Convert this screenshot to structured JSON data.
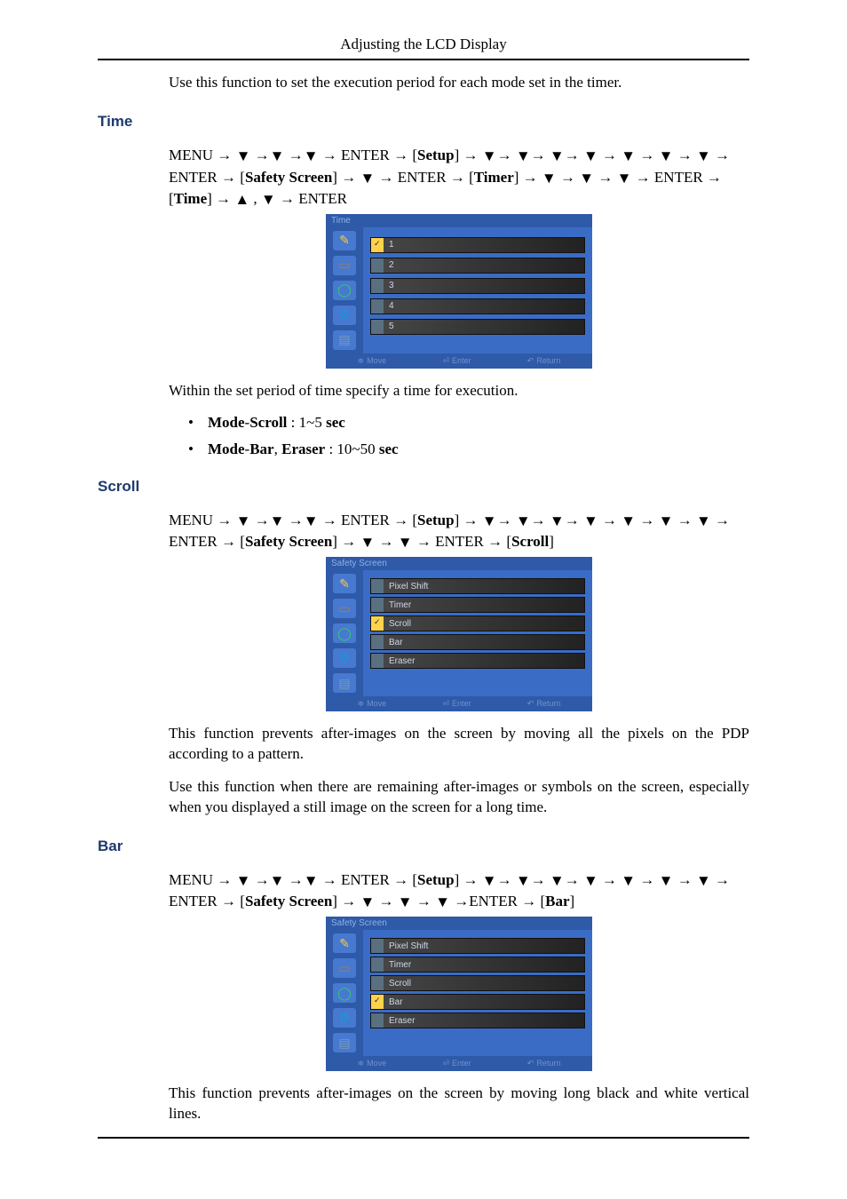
{
  "header_title": "Adjusting the LCD Display",
  "intro_para": "Use this function to set the execution period for each mode set in the timer.",
  "sections": {
    "time": {
      "heading": "Time",
      "nav_parts": {
        "p0": "MENU → ",
        "p1": " →",
        "p2": " →",
        "p3": " → ENTER → [",
        "setup": "Setup",
        "p4": "] → ",
        "p5": "→ ",
        "p6": "→ ",
        "p7": "→ ",
        "p8": " → ",
        "p9": " → ",
        "p10": " → ",
        "p11": " → ENTER → [",
        "safety": "Safety Screen",
        "p12": "] → ",
        "p13": " → ENTER → [",
        "timer": "Timer",
        "p14": "] → ",
        "p15": " → ",
        "p16": " → ",
        "p17": " → ENTER → [",
        "time": "Time",
        "p18": "] → ",
        "p19": " , ",
        "p20": " → ENTER"
      },
      "osd": {
        "title": "Time",
        "rows": [
          "1",
          "2",
          "3",
          "4",
          "5"
        ],
        "selected_index": 0,
        "foot": {
          "move": "Move",
          "enter": "Enter",
          "return": "Return"
        }
      },
      "para_after_osd": "Within the set period of time specify a time for execution.",
      "bullets": {
        "b1_pre": "Mode",
        "b1_dash1": "-",
        "b1_mid": "Scroll",
        "b1_post": " : 1~5 ",
        "b1_sec": "sec",
        "b2_pre": "Mode",
        "b2_dash1": "-",
        "b2_mid1": "Bar",
        "b2_comma": ", ",
        "b2_mid2": "Eraser",
        "b2_post": " : 10~50 ",
        "b2_sec": "sec"
      }
    },
    "scroll": {
      "heading": "Scroll",
      "nav_parts": {
        "p0": "MENU → ",
        "p1": " →",
        "p2": " →",
        "p3": " → ENTER → [",
        "setup": "Setup",
        "p4": "] → ",
        "p5": "→ ",
        "p6": "→ ",
        "p7": "→ ",
        "p8": " → ",
        "p9": " → ",
        "p10": " → ",
        "p11": " → ENTER → [",
        "safety": "Safety Screen",
        "p12": "] → ",
        "p13": " → ",
        "p14": " → ENTER → [",
        "scroll": "Scroll",
        "p15": "]"
      },
      "osd": {
        "title": "Safety Screen",
        "rows": [
          "Pixel Shift",
          "Timer",
          "Scroll",
          "Bar",
          "Eraser"
        ],
        "selected_index": 2,
        "foot": {
          "move": "Move",
          "enter": "Enter",
          "return": "Return"
        }
      },
      "para1": "This function prevents after-images on the screen by moving all the pixels on the PDP according to a pattern.",
      "para2": "Use this function when there are remaining after-images or symbols on the screen, especially when you displayed a still image on the screen for a long time."
    },
    "bar": {
      "heading": "Bar",
      "nav_parts": {
        "p0": "MENU → ",
        "p1": " →",
        "p2": " →",
        "p3": " → ENTER → [",
        "setup": "Setup",
        "p4": "] → ",
        "p5": "→ ",
        "p6": "→ ",
        "p7": "→ ",
        "p8": " → ",
        "p9": " → ",
        "p10": " → ",
        "p11": " → ENTER → [",
        "safety": "Safety Screen",
        "p12": "] → ",
        "p13": " → ",
        "p14": " → ",
        "p15": " →ENTER → [",
        "bar": "Bar",
        "p16": "]"
      },
      "osd": {
        "title": "Safety Screen",
        "rows": [
          "Pixel Shift",
          "Timer",
          "Scroll",
          "Bar",
          "Eraser"
        ],
        "selected_index": 3,
        "foot": {
          "move": "Move",
          "enter": "Enter",
          "return": "Return"
        }
      },
      "para1": "This function prevents after-images on the screen by moving long black and white vertical lines."
    }
  },
  "glyphs": {
    "down": "▼",
    "up": "▲"
  }
}
